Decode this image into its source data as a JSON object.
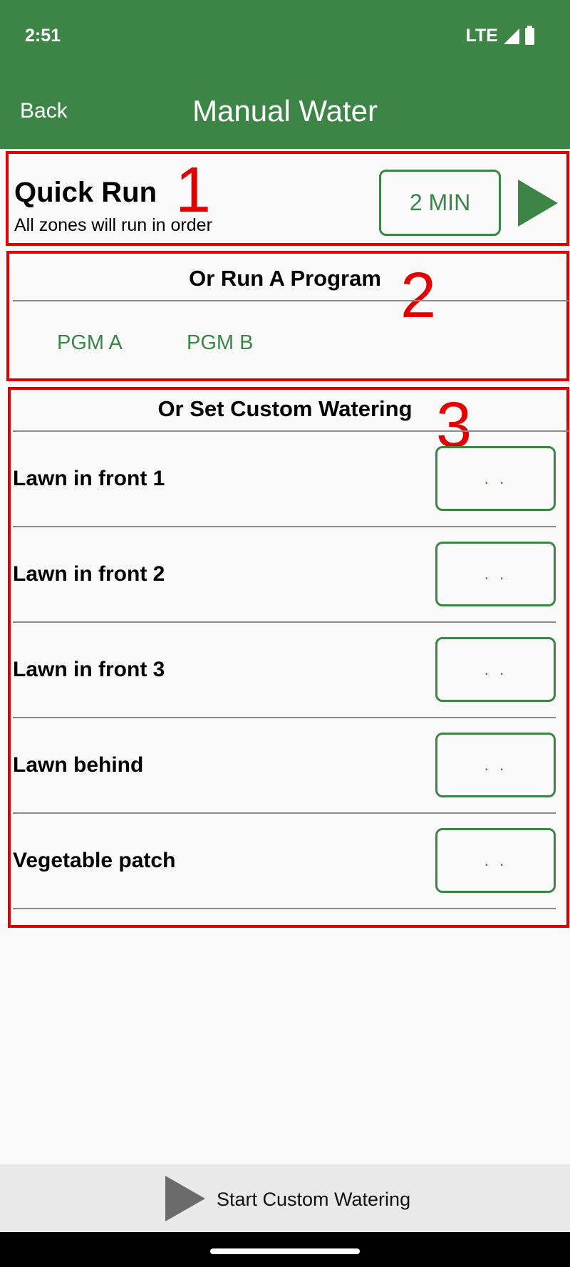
{
  "status_bar": {
    "time": "2:51",
    "network": "LTE",
    "signal_icon": "signal-icon",
    "battery_icon": "battery-icon"
  },
  "app_bar": {
    "back_label": "Back",
    "title": "Manual Water"
  },
  "quick_run": {
    "title": "Quick Run",
    "subtitle": "All zones will run in order",
    "duration_label": "2 MIN",
    "play_icon": "play-icon"
  },
  "programs": {
    "title": "Or Run A Program",
    "items": [
      "PGM A",
      "PGM B"
    ]
  },
  "custom": {
    "title": "Or Set Custom Watering",
    "zones": [
      {
        "name": "Lawn in front 1",
        "value": ". ."
      },
      {
        "name": "Lawn in front 2",
        "value": ". ."
      },
      {
        "name": "Lawn in front 3",
        "value": ". ."
      },
      {
        "name": "Lawn behind",
        "value": ". ."
      },
      {
        "name": "Vegetable patch",
        "value": ". ."
      }
    ]
  },
  "annotations": [
    "1",
    "2",
    "3"
  ],
  "bottom": {
    "start_label": "Start Custom Watering",
    "play_icon": "play-icon"
  },
  "colors": {
    "primary": "#3d8547",
    "annotation": "#e00000",
    "background": "#f9f9f9"
  }
}
